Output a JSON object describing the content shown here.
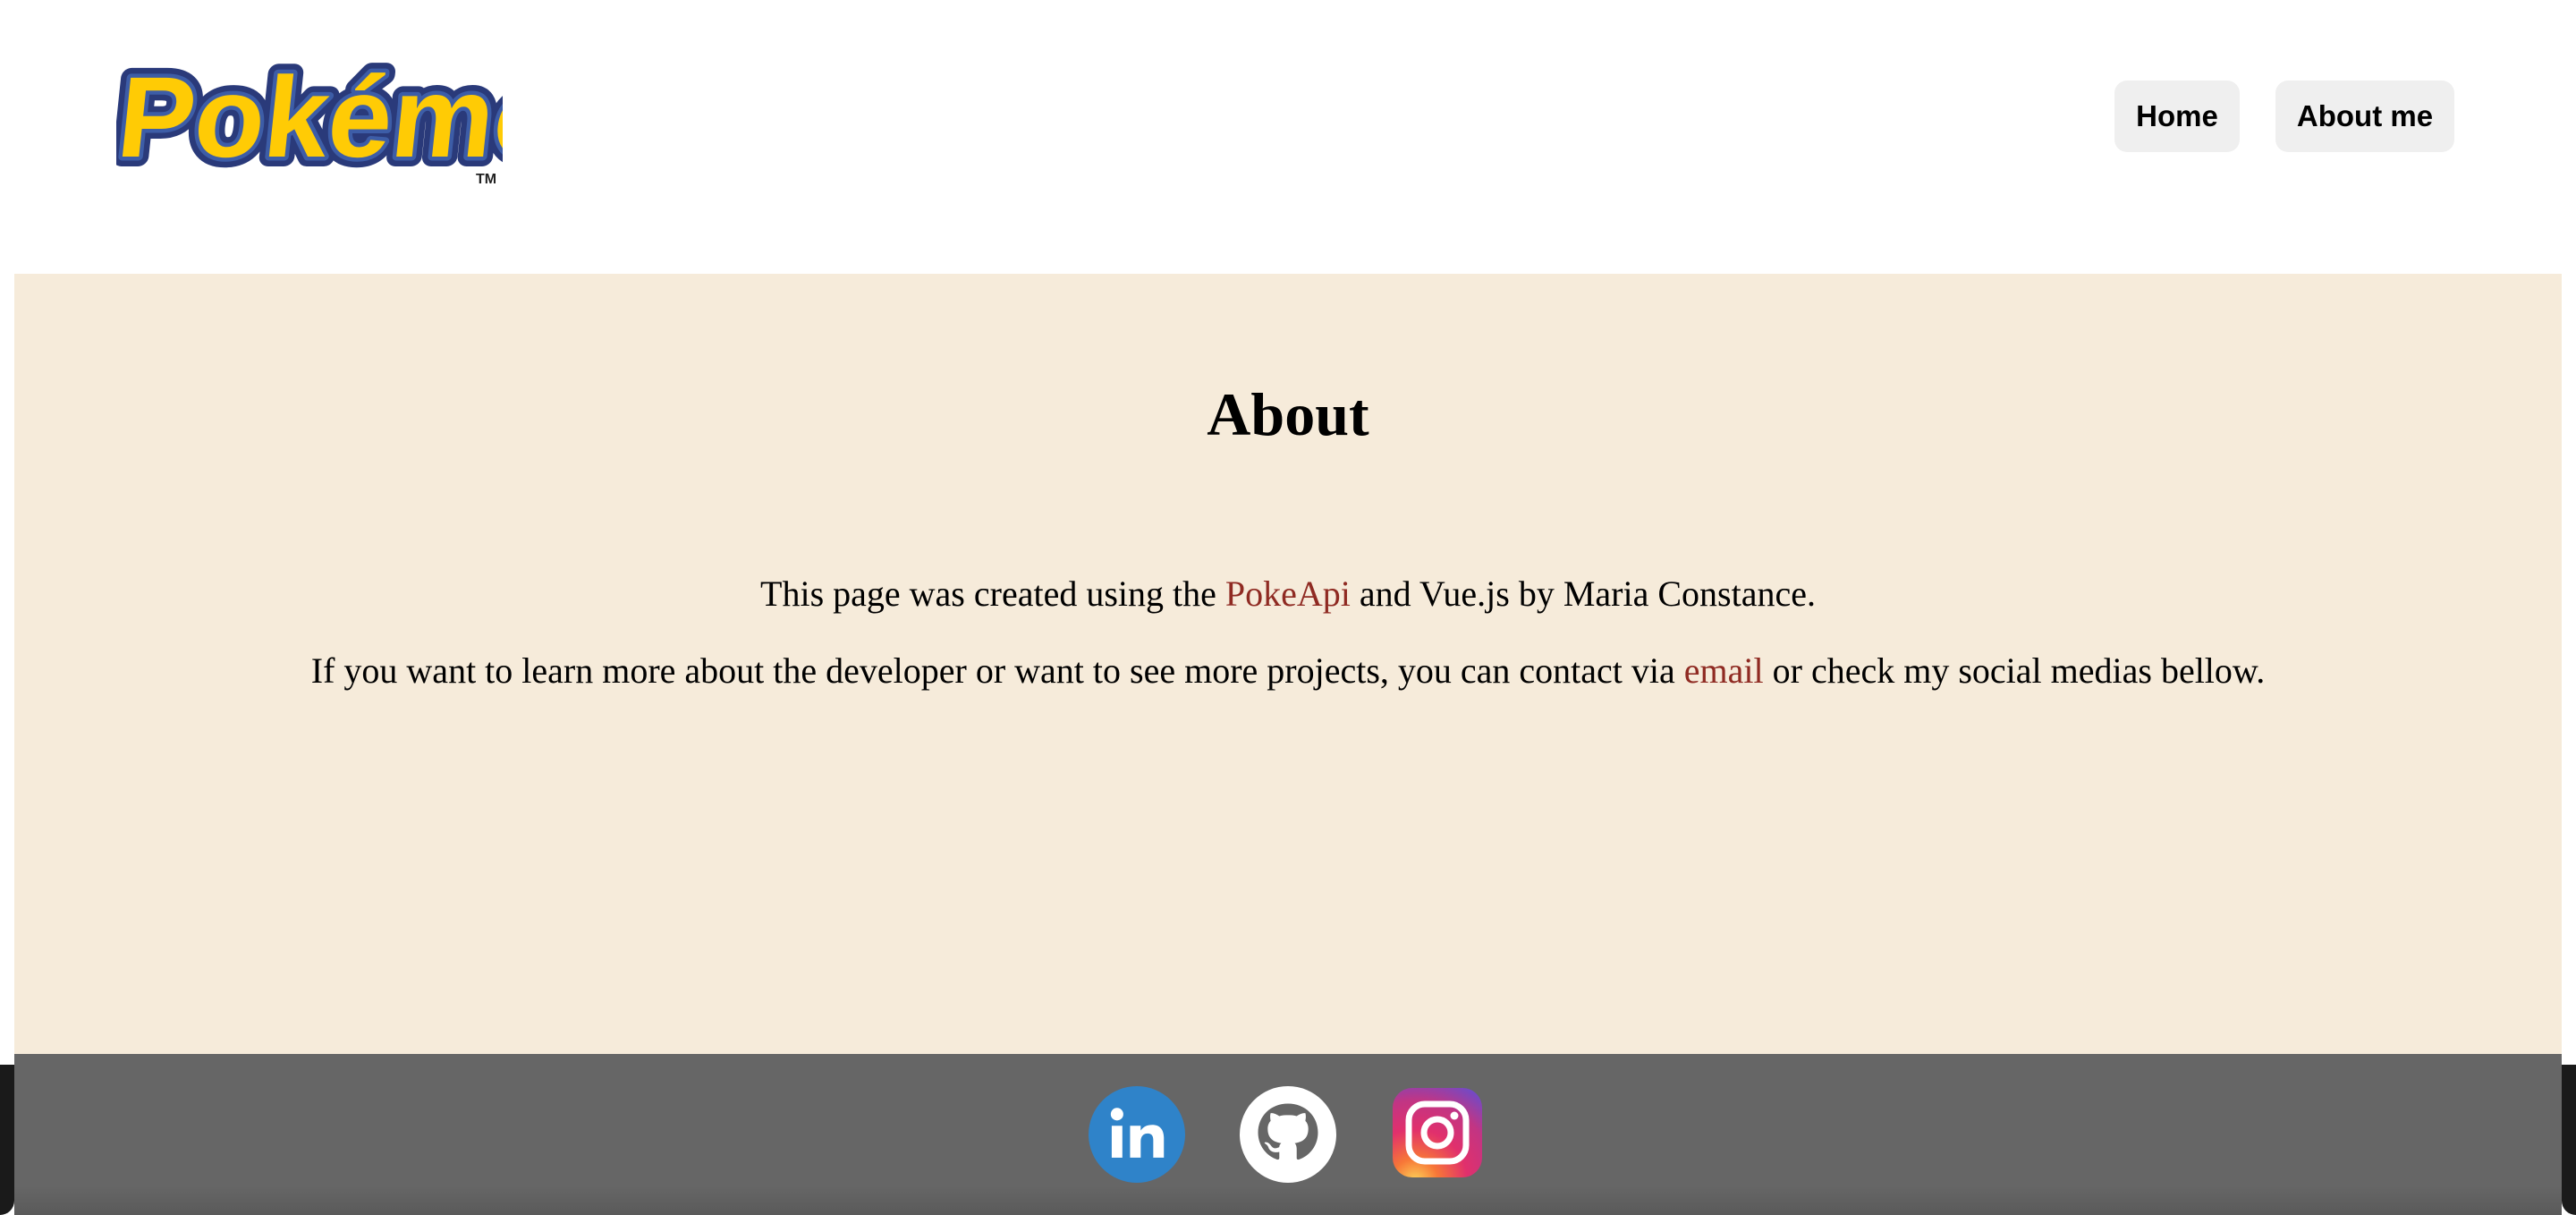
{
  "header": {
    "logo_text": "Pokémon",
    "logo_tm": "TM",
    "nav": [
      {
        "label": "Home"
      },
      {
        "label": "About me"
      }
    ]
  },
  "main": {
    "title": "About",
    "paragraph1": {
      "before": "This page was created using the ",
      "link": "PokeApi",
      "after": " and Vue.js by Maria Constance."
    },
    "paragraph2": {
      "before": "If you want to learn more about the developer or want to see more projects, you can contact via ",
      "link": "email",
      "after": " or check my social medias bellow."
    }
  },
  "footer": {
    "social": [
      {
        "icon": "linkedin-icon",
        "color": "#2f83c9"
      },
      {
        "icon": "github-icon",
        "color": "#ffffff"
      },
      {
        "icon": "instagram-icon",
        "color": "#c13584"
      }
    ]
  },
  "colors": {
    "main_background": "#f6ebda",
    "footer_background": "#666666",
    "link": "#8f2a22",
    "nav_button": "#efefef",
    "logo_yellow": "#ffcb05",
    "logo_blue": "#3d5da7"
  }
}
